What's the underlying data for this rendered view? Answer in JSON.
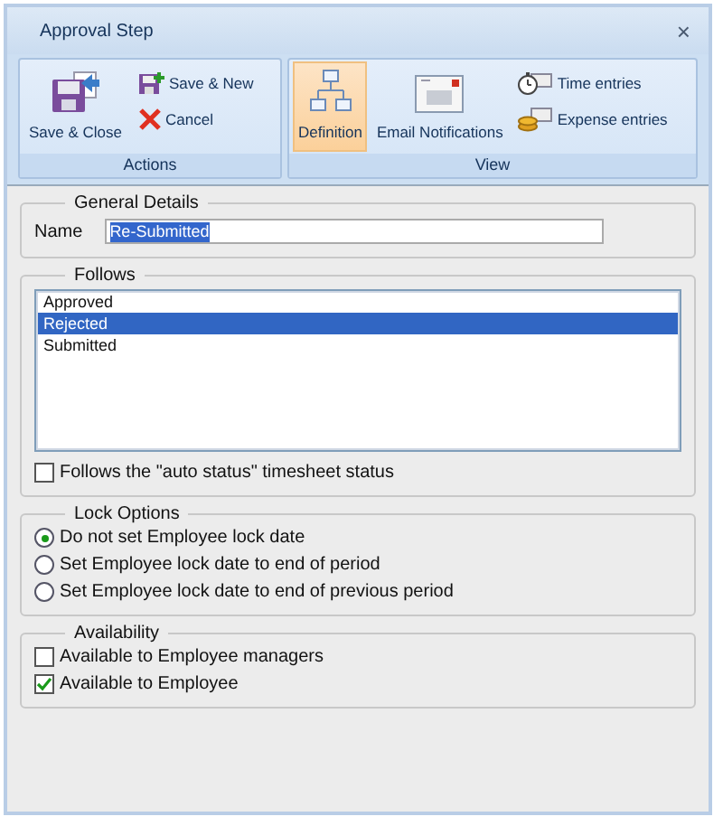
{
  "window": {
    "title": "Approval Step",
    "close": "×"
  },
  "ribbon": [
    {
      "label": "Actions",
      "buttons": [
        {
          "kind": "large",
          "label": "Save & Close",
          "selected": false
        },
        {
          "kind": "small",
          "label": "Save & New",
          "selected": false
        },
        {
          "kind": "small",
          "label": "Cancel",
          "selected": false
        }
      ]
    },
    {
      "label": "View",
      "buttons": [
        {
          "kind": "large",
          "label": "Definition",
          "selected": true
        },
        {
          "kind": "large",
          "label": "Email Notifications",
          "selected": false
        },
        {
          "kind": "small",
          "label": "Time entries",
          "selected": false
        },
        {
          "kind": "small",
          "label": "Expense entries",
          "selected": false
        }
      ]
    }
  ],
  "general": {
    "title": "General Details",
    "name_label": "Name",
    "name_value": "Re-Submitted"
  },
  "follows": {
    "title": "Follows",
    "items": [
      {
        "label": "Approved",
        "selected": false
      },
      {
        "label": "Rejected",
        "selected": true
      },
      {
        "label": "Submitted",
        "selected": false
      }
    ],
    "auto_status": {
      "label": "Follows the \"auto status\" timesheet status",
      "checked": false
    }
  },
  "lock_options": {
    "title": "Lock Options",
    "options": [
      {
        "label": "Do not set Employee lock date",
        "selected": true
      },
      {
        "label": "Set Employee lock date to end of period",
        "selected": false
      },
      {
        "label": "Set Employee lock date to end of previous period",
        "selected": false
      }
    ]
  },
  "availability": {
    "title": "Availability",
    "options": [
      {
        "label": "Available to Employee managers",
        "checked": false
      },
      {
        "label": "Available to Employee",
        "checked": true
      }
    ]
  }
}
